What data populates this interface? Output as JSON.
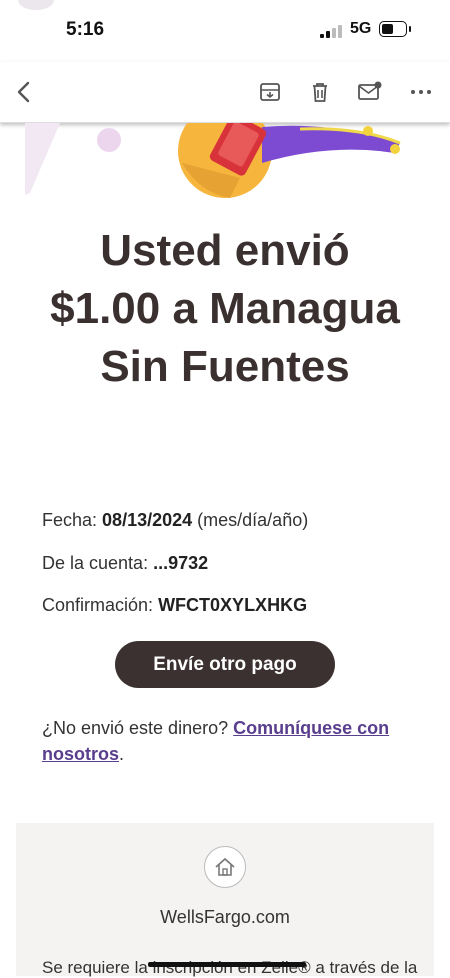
{
  "status": {
    "time": "5:16",
    "network": "5G"
  },
  "toolbar": {
    "back": "back-icon",
    "archive": "archive-icon",
    "delete": "trash-icon",
    "unread": "mail-unread-icon",
    "more": "more-icon"
  },
  "email": {
    "headline": "Usted envió $1.00 a Managua Sin Fuentes",
    "details": {
      "date_label": "Fecha:",
      "date_value": "08/13/2024",
      "date_format": "(mes/día/año)",
      "account_label": "De la cuenta:",
      "account_value": "...9732",
      "confirmation_label": "Confirmación:",
      "confirmation_value": "WFCT0XYLXHKG"
    },
    "send_again_button": "Envíe otro pago",
    "question_text": "¿No envió este dinero?",
    "contact_link": "Comuníquese con nosotros",
    "question_end": "."
  },
  "footer": {
    "home_icon": "home-icon",
    "site": "WellsFargo.com",
    "note": "Se requiere la inscripción en Zelle® a través de la"
  },
  "colors": {
    "headline": "#3a3030",
    "button": "#3b3131",
    "link": "#5a3e8e",
    "footer_bg": "#f5f3f2"
  }
}
